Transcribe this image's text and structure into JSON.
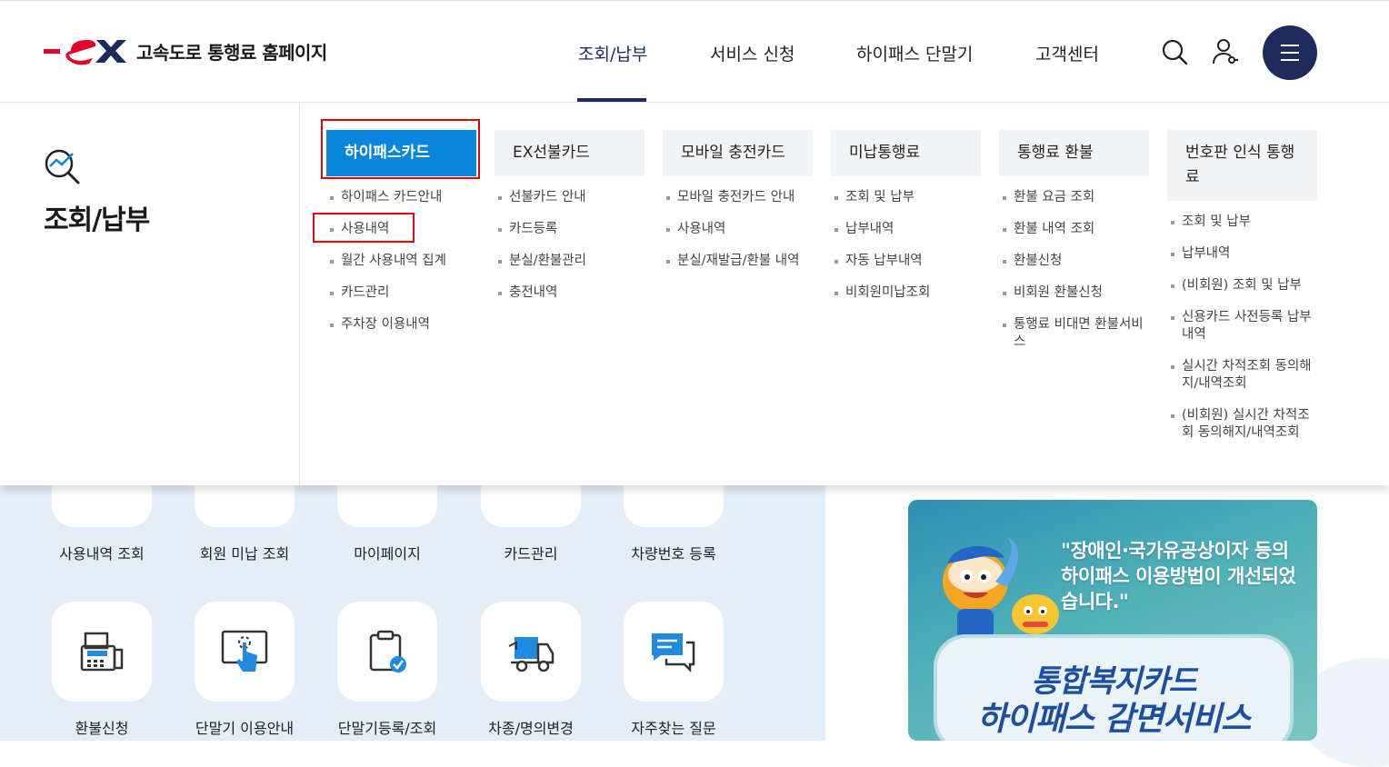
{
  "header": {
    "logo_mark": "ex",
    "site_title": "고속도로 통행료 홈페이지",
    "nav": [
      "조회/납부",
      "서비스 신청",
      "하이패스 단말기",
      "고객센터"
    ],
    "active_nav": "조회/납부",
    "icons": [
      "search-icon",
      "user-icon",
      "menu-icon"
    ]
  },
  "mega_menu": {
    "section_title": "조회/납부",
    "section_icon": "search-chart-icon",
    "columns": [
      {
        "title": "하이패스카드",
        "active": true,
        "items": [
          "하이패스 카드안내",
          "사용내역",
          "월간 사용내역 집계",
          "카드관리",
          "주차장 이용내역"
        ]
      },
      {
        "title": "EX선불카드",
        "items": [
          "선불카드 안내",
          "카드등록",
          "분실/환불관리",
          "충전내역"
        ]
      },
      {
        "title": "모바일 충전카드",
        "items": [
          "모바일 충전카드 안내",
          "사용내역",
          "분실/재발급/환불 내역"
        ]
      },
      {
        "title": "미납통행료",
        "items": [
          "조회 및 납부",
          "납부내역",
          "자동 납부내역",
          "비회원미납조회"
        ]
      },
      {
        "title": "통행료 환불",
        "items": [
          "환불 요금 조회",
          "환불 내역 조회",
          "환불신청",
          "비회원 환불신청",
          "통행료 비대면 환불서비스"
        ]
      },
      {
        "title": "번호판 인식 통행료",
        "items": [
          "조회 및 납부",
          "납부내역",
          "(비회원) 조회 및 납부",
          "신용카드 사전등록 납부내역",
          "실시간 차적조회 동의해지/내역조회",
          "(비회원) 실시간 차적조회 동의해지/내역조회"
        ]
      }
    ]
  },
  "quick_menu": {
    "row1": [
      "사용내역 조회",
      "회원 미납 조회",
      "마이페이지",
      "카드관리",
      "차량번호 등록"
    ],
    "row2": [
      "환불신청",
      "단말기 이용안내",
      "단말기등록/조회",
      "차종/명의변경",
      "자주찾는 질문"
    ]
  },
  "banner": {
    "quote": "\"장애인·국가유공상이자 등의 하이패스 이용방법이 개선되었습니다.\"",
    "title_line1": "통합복지카드",
    "title_line2": "하이패스 감면서비스"
  },
  "colors": {
    "brand_navy": "#1c2b5c",
    "active_blue": "#0b86dc",
    "logo_red": "#e4002b",
    "highlight_red": "#e60012"
  }
}
